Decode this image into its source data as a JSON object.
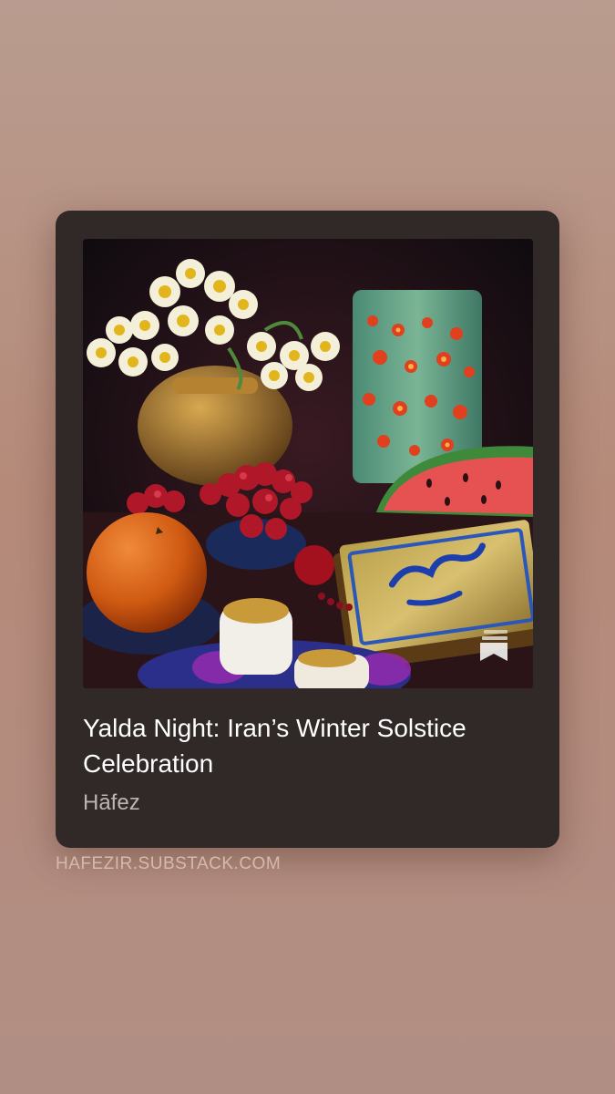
{
  "post": {
    "title": "Yalda Night: Iran’s Winter Solstice Celebration",
    "author": "Hāfez",
    "domain": "HAFEZIR.SUBSTACK.COM",
    "image_overlay_icon": "bookmark-stack-icon"
  },
  "colors": {
    "background_top": "#b99c8f",
    "card": "#312927",
    "title_text": "#ffffff",
    "author_text": "#bdb5b1",
    "domain_text": "#d6b9ad"
  }
}
